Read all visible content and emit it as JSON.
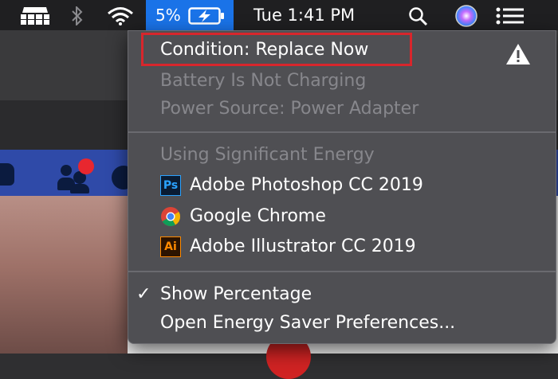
{
  "menubar": {
    "battery_percent": "5%",
    "clock": "Tue 1:41 PM",
    "icons": [
      "desktop-icon",
      "bluetooth-icon",
      "wifi-icon",
      "battery-charging-icon",
      "spotlight-search-icon",
      "siri-icon",
      "notification-center-icon"
    ]
  },
  "menu": {
    "condition": "Condition: Replace Now",
    "charging_status": "Battery Is Not Charging",
    "power_source": "Power Source: Power Adapter",
    "energy_header": "Using Significant Energy",
    "apps": [
      {
        "name": "Adobe Photoshop CC 2019",
        "icon": "photoshop-icon",
        "glyph": "Ps"
      },
      {
        "name": "Google Chrome",
        "icon": "chrome-icon"
      },
      {
        "name": "Adobe Illustrator CC 2019",
        "icon": "illustrator-icon",
        "glyph": "Ai"
      }
    ],
    "show_percentage": "Show Percentage",
    "show_percentage_checked": true,
    "check_glyph": "✓",
    "open_prefs": "Open Energy Saver Preferences..."
  },
  "colors": {
    "accent": "#1a73e8",
    "highlight_box": "#d8262c",
    "menu_bg": "#4f4f53"
  }
}
